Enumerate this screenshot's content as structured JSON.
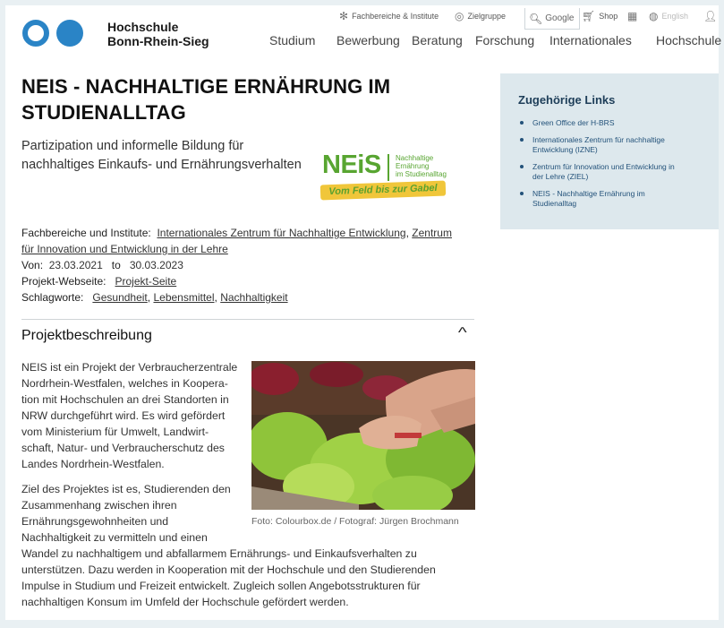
{
  "header": {
    "brand_line1": "Hochschule",
    "brand_line2": "Bonn-Rhein-Sieg",
    "util": {
      "fachbereiche": "Fachbereiche & Institute",
      "zielgruppe": "Zielgruppe",
      "search_placeholder": "Google",
      "shop": "Shop",
      "english": "English"
    },
    "nav": [
      "Studium",
      "Bewerbung",
      "Beratung",
      "Forschung",
      "Internationales",
      "Hochschule"
    ]
  },
  "main": {
    "title_line1": "NEIS - NACHHALTIGE ERNÄHRUNG IM",
    "title_line2": "STUDIENALLTAG",
    "subtitle_line1": "Partizipation und informelle Bildung für",
    "subtitle_line2": "nachhaltiges Einkaufs- und Ernährungsverhalten",
    "logo": {
      "word": "NEiS",
      "side_line1": "Nachhaltige",
      "side_line2": "Ernährung",
      "side_line3": "im Studienalltag",
      "ribbon": "Vom Feld bis zur Gabel"
    },
    "meta": {
      "fachbereiche_label": "Fachbereiche und Institute:",
      "fachbereiche_link1": "Internationales Zentrum für Nachhaltige Entwicklung",
      "fachbereiche_sep": ",",
      "fachbereiche_link2a": "Zentrum",
      "fachbereiche_link2b": "für Innovation und Entwicklung in der Lehre",
      "von_label": "Von:",
      "von_start": "23.03.2021",
      "von_to": "to",
      "von_end": "30.03.2023",
      "webseite_label": "Projekt-Webseite:",
      "webseite_link": "Projekt-Seite",
      "schlagworte_label": "Schlagworte:",
      "tag1": "Gesundheit",
      "tag2": "Lebensmittel",
      "tag3": "Nachhaltigkeit",
      "comma": ","
    },
    "accordion_title": "Projektbeschreibung",
    "para1": [
      "NEIS ist ein Projekt der Verbraucherzentrale",
      "Nordrhein-Westfalen, welches in Koopera-",
      "tion mit Hochschulen an drei Standorten in",
      "NRW durchgeführt wird. Es wird gefördert",
      "vom Ministerium für Umwelt, Landwirt-",
      "schaft, Natur- und Verbraucherschutz des",
      "Landes Nordrhein-Westfalen."
    ],
    "para2": [
      "Ziel des Projektes ist es, Studierenden den",
      "Zusammenhang zwischen ihren",
      "Ernährungsgewohnheiten und",
      "Nachhaltigkeit zu vermitteln und einen",
      "Wandel zu nachhaltigem und abfallarmem Ernährungs- und Einkaufsverhalten zu",
      "unterstützen. Dazu werden in Kooperation mit der Hochschule und den Studierenden",
      "Impulse in Studium und Freizeit entwickelt. Zugleich sollen Angebotsstrukturen für",
      "nachhaltigen Konsum im Umfeld der Hochschule gefördert werden."
    ],
    "photo_caption": "Foto: Colourbox.de / Fotograf: Jürgen Brochmann"
  },
  "sidebar": {
    "title": "Zugehörige Links",
    "links": [
      [
        "Green Office der H-BRS"
      ],
      [
        "Internationales Zentrum für nachhaltige",
        "Entwicklung (IZNE)"
      ],
      [
        "Zentrum für Innovation und Entwicklung in",
        "der Lehre (ZIEL)"
      ],
      [
        "NEIS - Nachhaltige Ernährung im",
        "Studienalltag"
      ]
    ]
  }
}
